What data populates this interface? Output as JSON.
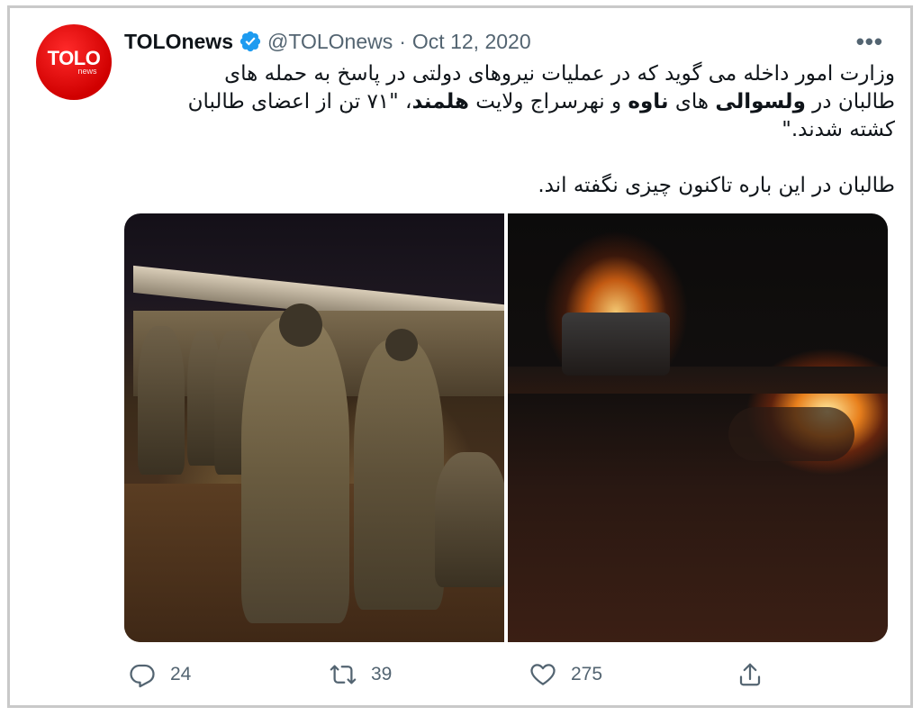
{
  "author": {
    "avatar_logo_text": "TOLO",
    "avatar_logo_sub": "news",
    "display_name": "TOLOnews",
    "handle": "@TOLOnews",
    "separator": "·",
    "date": "Oct 12, 2020",
    "verified": true
  },
  "more_menu": "•••",
  "tweet": {
    "line1": "وزارت امور داخله می گوید که در عملیات نیروهای دولتی در پاسخ به حمله های",
    "line2_a": "طالبان در ",
    "line2_b": "ولسوالی",
    "line2_c": " های ",
    "line2_d": "ناوه",
    "line2_e": " و نهرسراج ولایت ",
    "line2_f": "هلمند",
    "line2_g": "، \"۷۱ تن از اعضای طالبان",
    "line3": "کشته شدند.\"",
    "line4": "طالبان در این باره تاکنون چیزی نگفته اند."
  },
  "media": {
    "left_photo": "soldiers-at-night",
    "right_photo": "burning-vehicles"
  },
  "actions": {
    "reply_count": "24",
    "retweet_count": "39",
    "like_count": "275"
  },
  "colors": {
    "verified": "#1d9bf0",
    "muted": "#536471",
    "avatar": "#e00000"
  }
}
